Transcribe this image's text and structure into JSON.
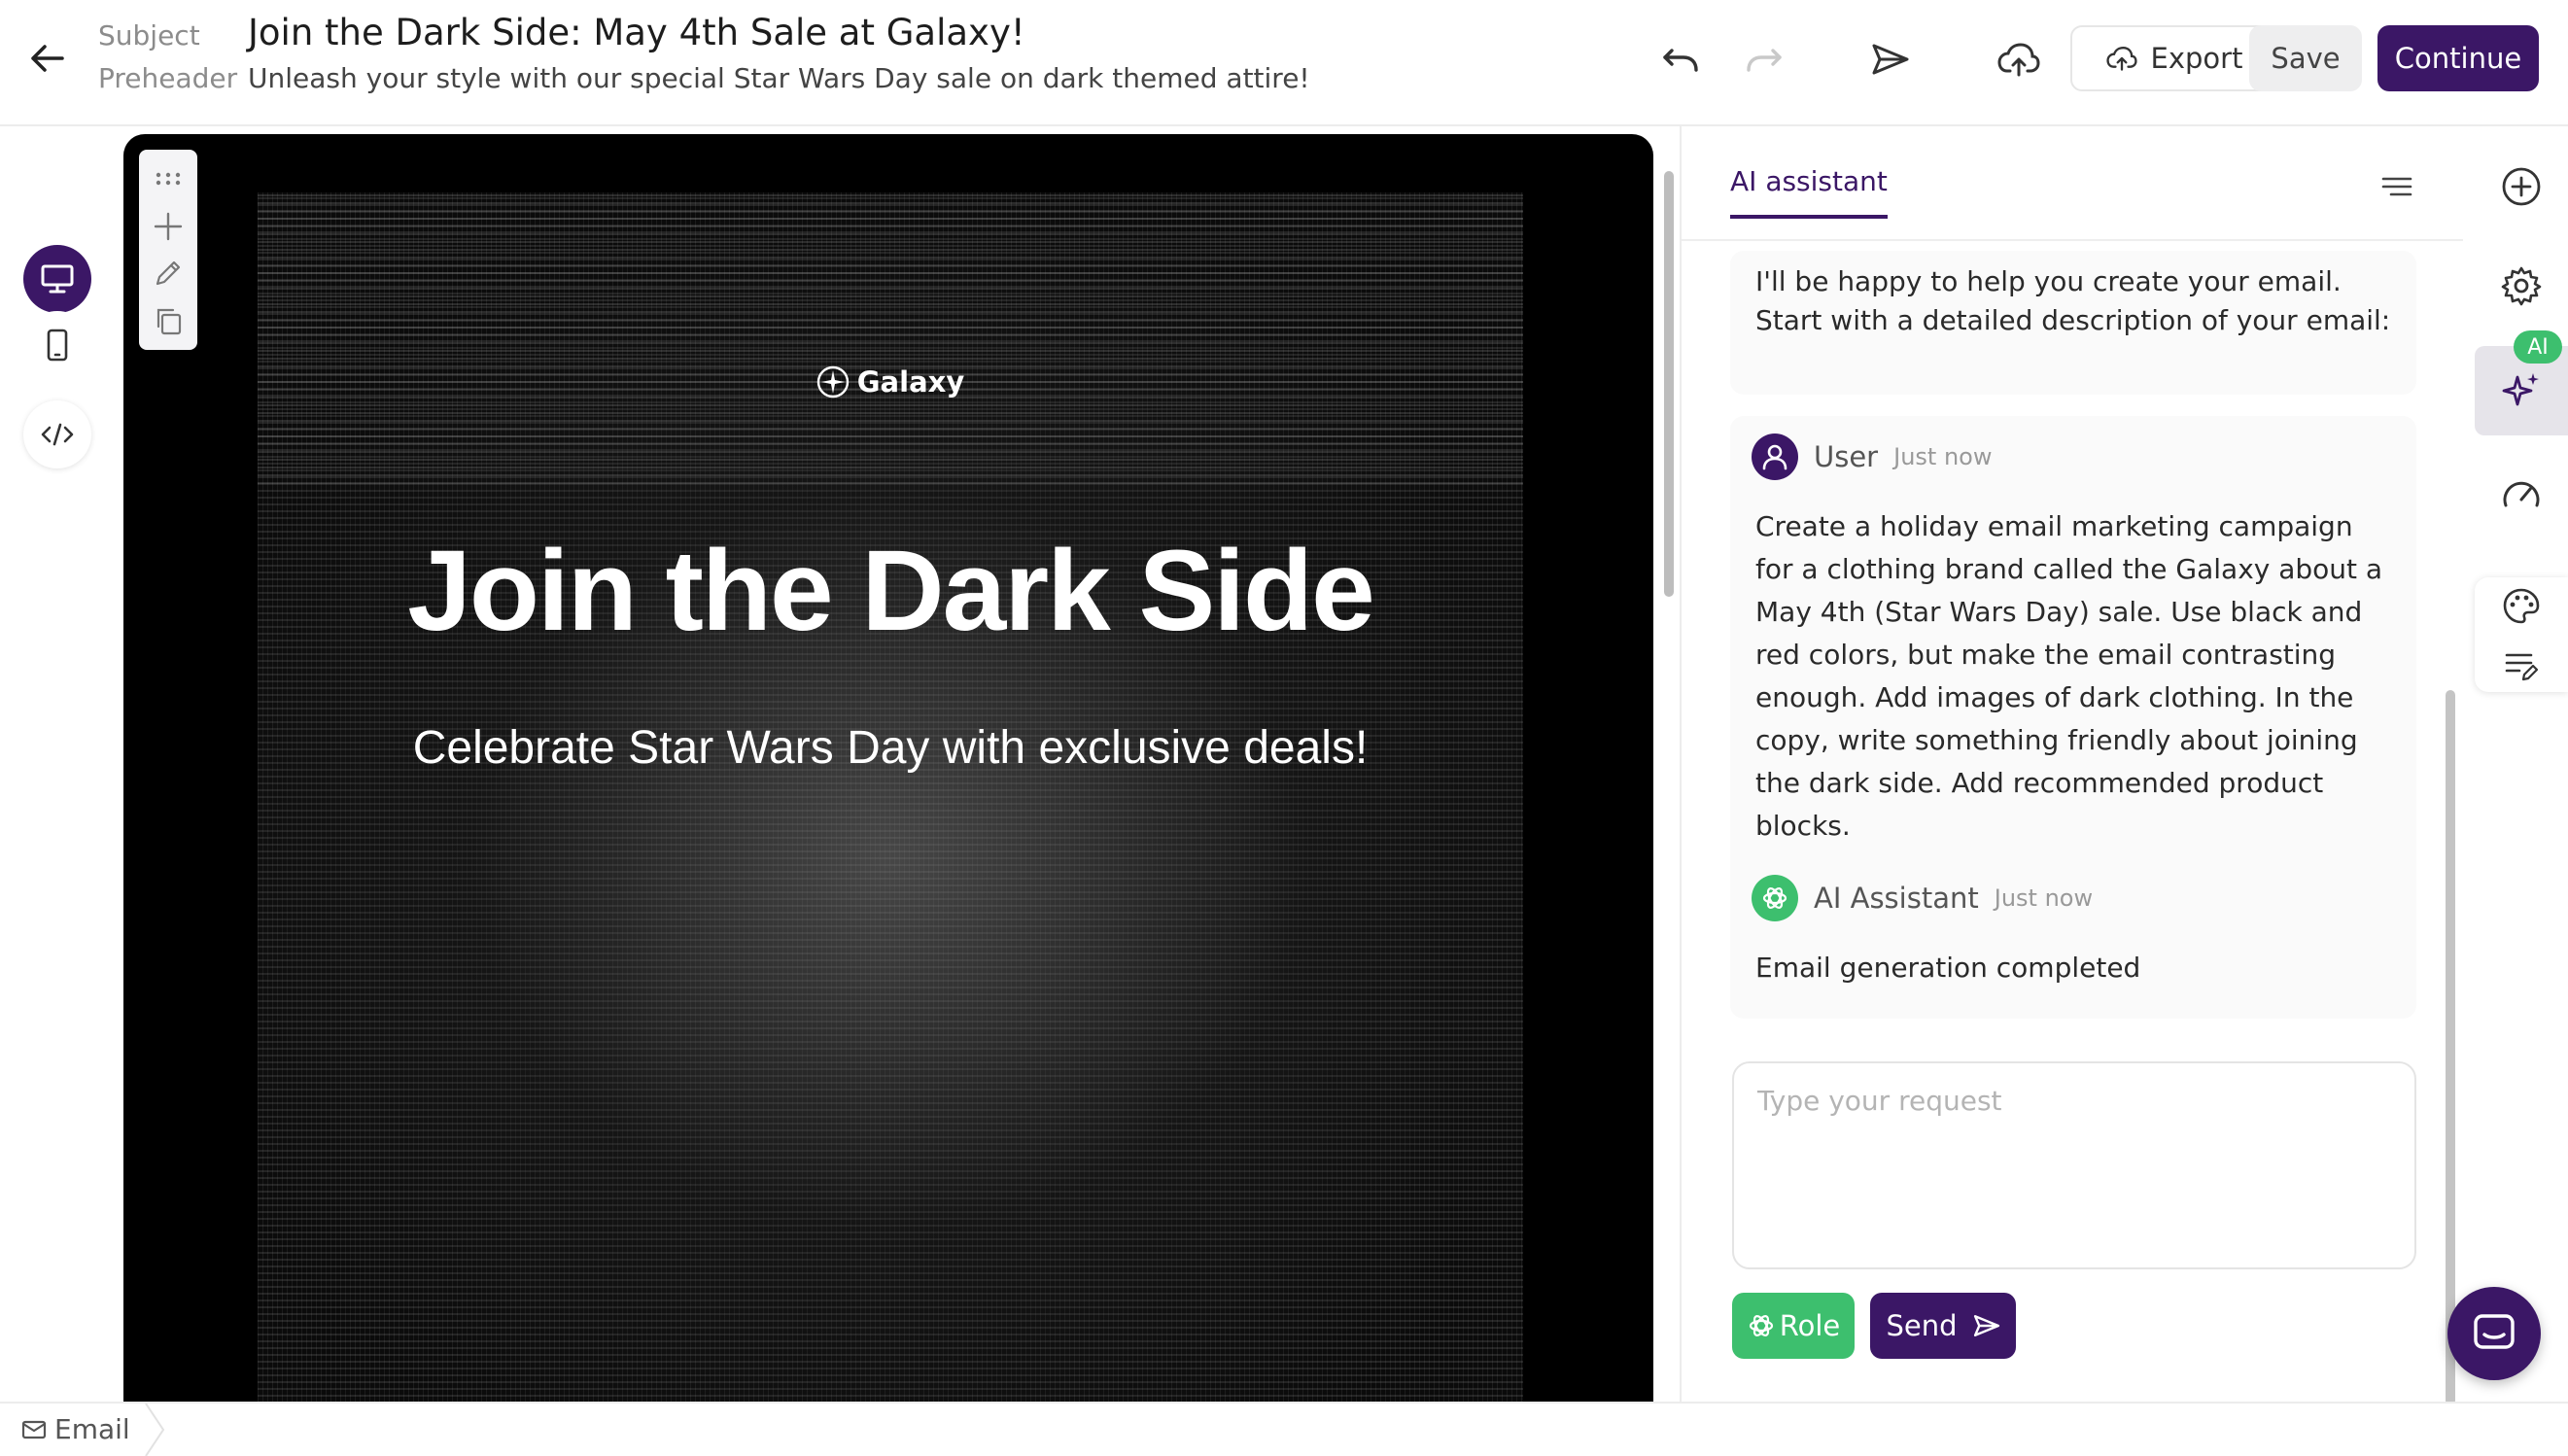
{
  "header": {
    "subject_label": "Subject",
    "subject": "Join the Dark Side: May 4th Sale at Galaxy!",
    "preheader_label": "Preheader",
    "preheader": "Unleash your style with our special Star Wars Day sale on dark themed attire!",
    "export_label": "Export",
    "save_label": "Save",
    "continue_label": "Continue"
  },
  "email": {
    "brand": "Galaxy",
    "title": "Join the Dark Side",
    "subtitle": "Celebrate Star Wars Day with exclusive deals!"
  },
  "panel": {
    "tab_label": "AI assistant",
    "intro": "I'll be happy to help you create your email. Start with a detailed description of your email:",
    "messages": [
      {
        "sender": "User",
        "time": "Just now",
        "text": "Create a holiday email marketing campaign for a clothing brand called the Galaxy about a May 4th (Star Wars Day) sale. Use black and red colors, but make the email contrasting enough. Add images of dark clothing. In the copy, write something friendly about joining the dark side. Add recommended product blocks."
      },
      {
        "sender": "AI Assistant",
        "time": "Just now",
        "text": "Email generation completed"
      }
    ],
    "input_placeholder": "Type your request",
    "role_label": "Role",
    "send_label": "Send"
  },
  "rail": {
    "ai_badge": "AI"
  },
  "footer": {
    "email_tab": "Email"
  },
  "colors": {
    "accent": "#3b1766",
    "green": "#3dbf6e",
    "canvas_bg": "#000000"
  },
  "icons": [
    "arrow-left-icon",
    "undo-icon",
    "redo-icon",
    "send-test-icon",
    "cloud-upload-icon",
    "export-cloud-icon",
    "desktop-icon",
    "mobile-icon",
    "code-icon",
    "drag-handle-icon",
    "plus-icon",
    "pencil-icon",
    "copy-icon",
    "menu-lines-icon",
    "user-icon",
    "openai-icon",
    "add-circle-icon",
    "gear-icon",
    "sparkle-icon",
    "gauge-icon",
    "palette-icon",
    "edit-list-icon",
    "chat-icon",
    "mail-icon"
  ]
}
